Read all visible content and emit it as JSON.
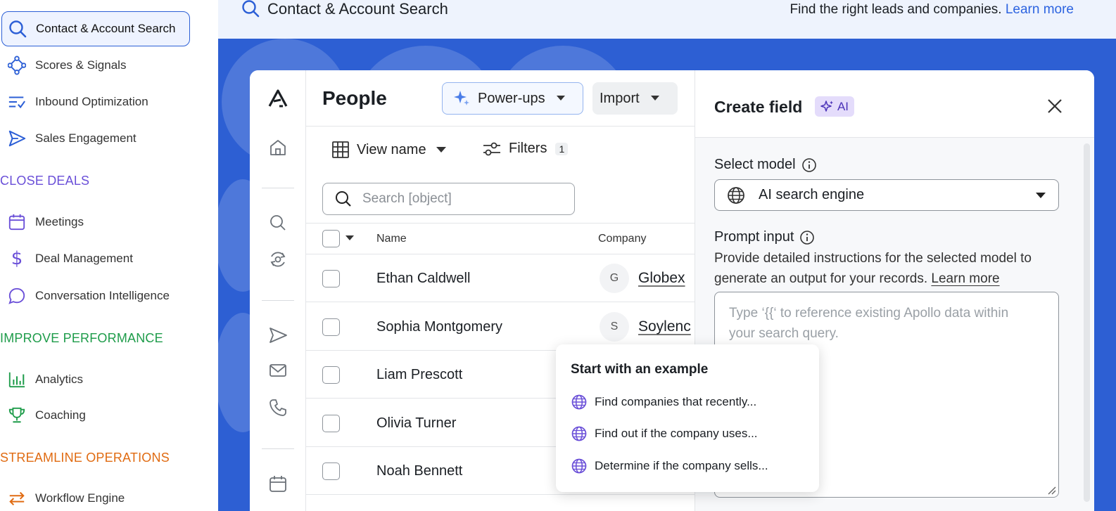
{
  "nav": {
    "items": [
      {
        "label": "Contact & Account Search",
        "icon": "search-icon",
        "active": true
      },
      {
        "label": "Scores & Signals",
        "icon": "network-icon"
      },
      {
        "label": "Inbound Optimization",
        "icon": "checklist-icon"
      },
      {
        "label": "Sales Engagement",
        "icon": "send-icon"
      },
      {
        "label": "Meetings",
        "icon": "calendar-icon"
      },
      {
        "label": "Deal Management",
        "icon": "dollar-icon"
      },
      {
        "label": "Conversation Intelligence",
        "icon": "chat-bubble-icon"
      },
      {
        "label": "Analytics",
        "icon": "bar-chart-icon"
      },
      {
        "label": "Coaching",
        "icon": "trophy-icon"
      },
      {
        "label": "Workflow Engine",
        "icon": "arrows-swap-icon"
      }
    ],
    "sections": {
      "close_deals": "CLOSE DEALS",
      "improve_performance": "IMPROVE PERFORMANCE",
      "streamline_operations": "STREAMLINE OPERATIONS"
    },
    "colors": {
      "blue": "#2c5fd6",
      "purple": "#6a4fd8",
      "green": "#1e9c4a",
      "orange": "#e06b12"
    }
  },
  "banner": {
    "title": "Contact & Account Search",
    "tagline": "Find the right leads and companies.",
    "learn_more": "Learn more"
  },
  "app": {
    "page_title": "People",
    "power_ups_label": "Power-ups",
    "import_label": "Import",
    "view_name_label": "View name",
    "filters_label": "Filters",
    "filters_count": "1",
    "search_placeholder": "Search [object]",
    "columns": {
      "name": "Name",
      "company": "Company"
    },
    "rows": [
      {
        "name": "Ethan Caldwell",
        "company_initial": "G",
        "company": "Globex"
      },
      {
        "name": "Sophia Montgomery",
        "company_initial": "S",
        "company": "Soylenc"
      },
      {
        "name": "Liam Prescott",
        "company_initial": "",
        "company": ""
      },
      {
        "name": "Olivia Turner",
        "company_initial": "",
        "company": ""
      },
      {
        "name": "Noah Bennett",
        "company_initial": "",
        "company": ""
      }
    ]
  },
  "panel": {
    "title": "Create field",
    "ai_badge": "AI",
    "select_model_label": "Select model",
    "selected_model": "AI search engine",
    "prompt_label": "Prompt input",
    "helper_text": "Provide detailed instructions for the selected model to generate an output for your records.",
    "helper_link": "Learn more",
    "prompt_placeholder": "Type ‘{{‘ to reference existing Apollo data within your search query."
  },
  "examples": {
    "title": "Start with an example",
    "items": [
      "Find companies that recently...",
      "Find out if the company uses...",
      "Determine if the company sells..."
    ]
  }
}
